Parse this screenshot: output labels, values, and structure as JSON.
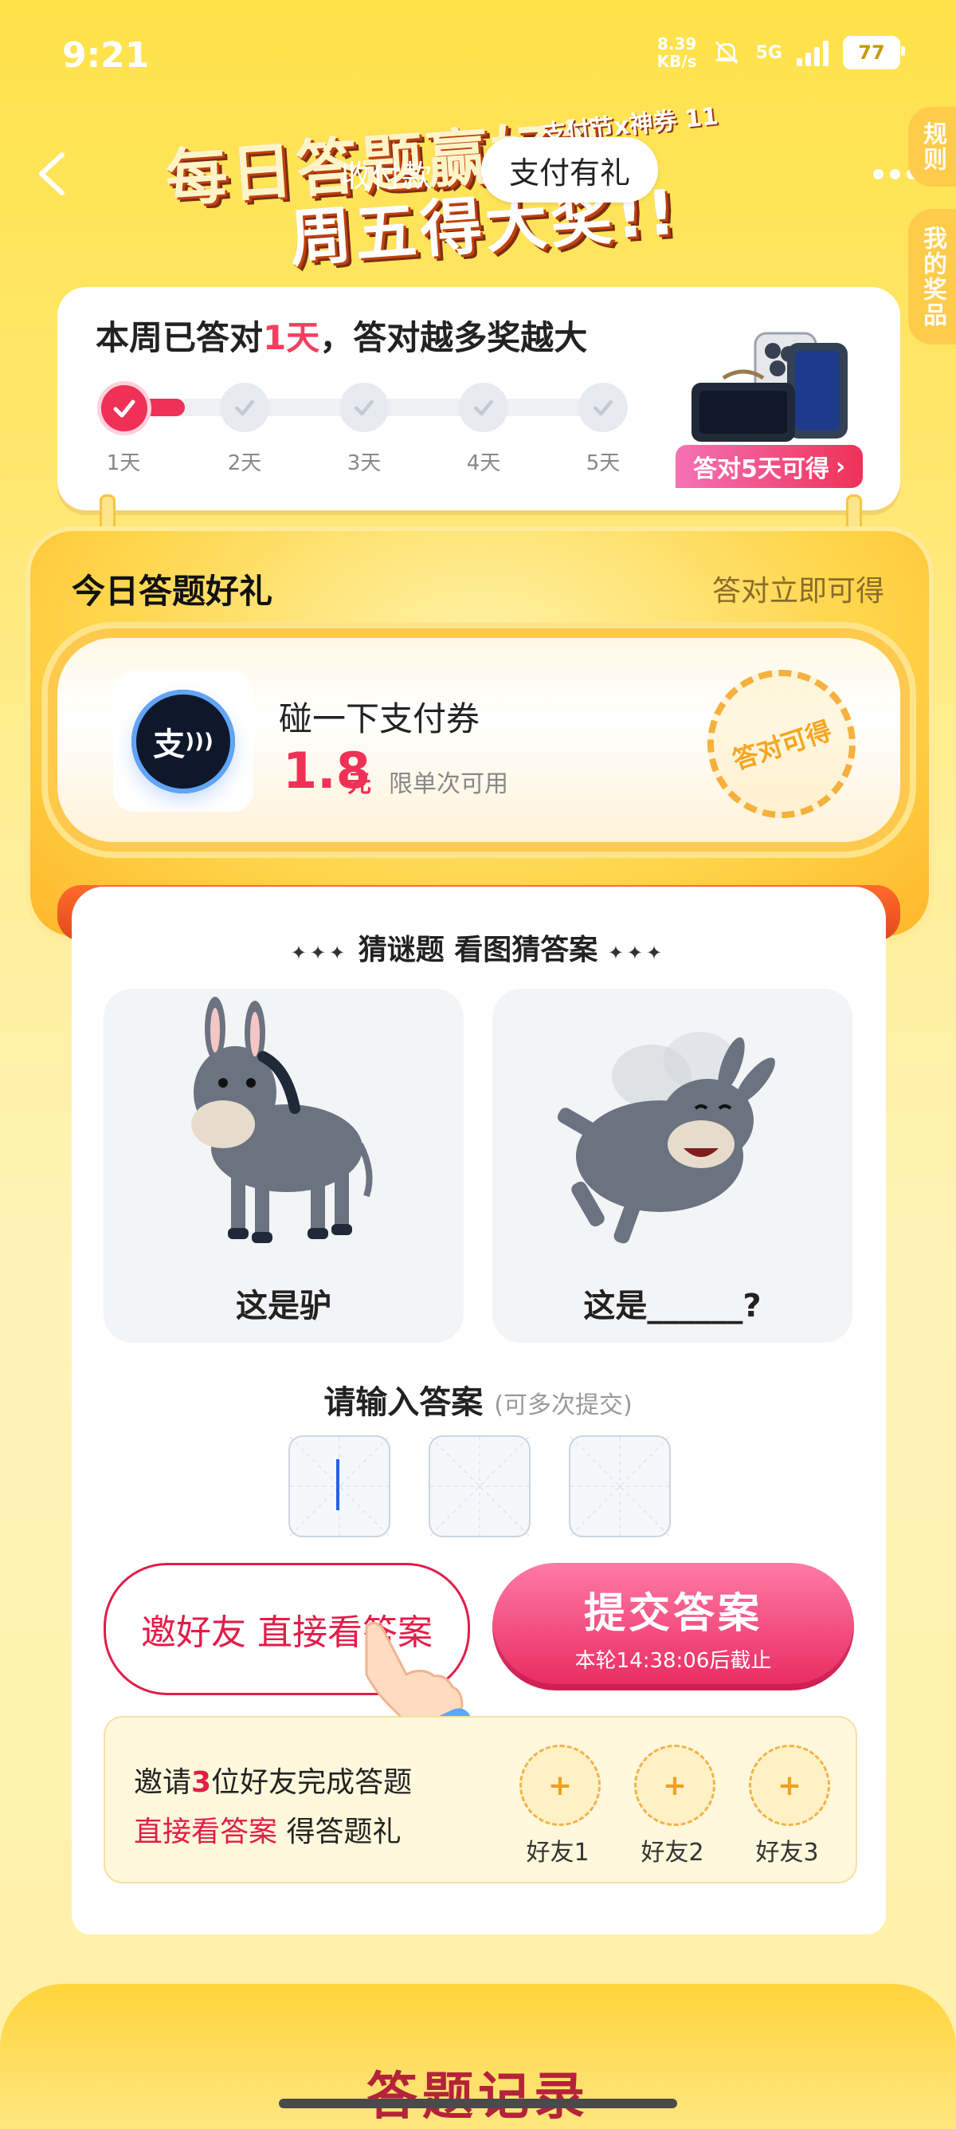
{
  "status_bar": {
    "time": "9:21",
    "net_speed_value": "8.39",
    "net_speed_unit": "KB/s",
    "network": "5G",
    "battery": "77"
  },
  "header": {
    "banner_line1": "每日答题赢好礼",
    "banner_line2": "周五得大奖!!",
    "banner_sub": "支付节x神券 11",
    "tab_inactive": "收付款",
    "tab_active": "支付有礼",
    "side_rules": "规则",
    "side_prizes": "我的奖品"
  },
  "progress": {
    "title_prefix": "本周已答对",
    "title_days": "1天",
    "title_suffix": "，答对越多奖越大",
    "days": [
      "1天",
      "2天",
      "3天",
      "4天",
      "5天"
    ],
    "completed_days": 1,
    "prize_badge": "答对5天可得"
  },
  "gift": {
    "title": "今日答题好礼",
    "hint": "答对立即可得",
    "coupon_logo": "支",
    "coupon_name": "碰一下支付券",
    "coupon_amount": "1.8",
    "coupon_unit": "元",
    "coupon_limit": "限单次可用",
    "stamp": "答对可得"
  },
  "quiz": {
    "heading": "猜谜题 看图猜答案",
    "left_caption": "这是驴",
    "right_caption": "这是______?",
    "answer_label": "请输入答案",
    "answer_hint": "(可多次提交)",
    "invite_button": "邀好友 直接看答案",
    "submit_button": "提交答案",
    "submit_deadline": "本轮14:38:06后截止"
  },
  "invite": {
    "line1_prefix": "邀请",
    "line1_count": "3",
    "line1_suffix": "位好友完成答题",
    "line2_red": "直接看答案",
    "line2_rest": " 得答题礼",
    "friends": [
      "好友1",
      "好友2",
      "好友3"
    ],
    "slot_symbol": "+"
  },
  "bottom": {
    "section_title": "答题记录"
  },
  "colors": {
    "accent_red": "#ef3157",
    "banner_yellow": "#ffe24a",
    "submit_pink": "#e8295e"
  }
}
